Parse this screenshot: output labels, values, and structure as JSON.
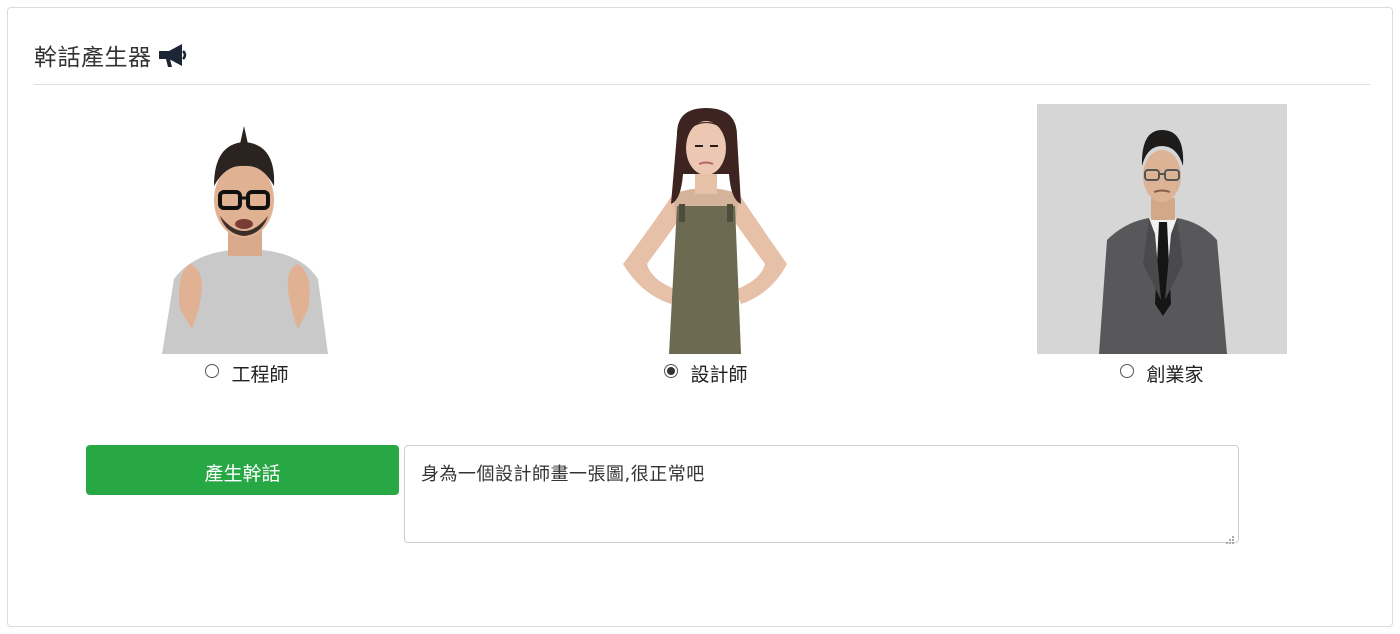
{
  "page": {
    "title": "幹話產生器",
    "title_icon": "megaphone-icon"
  },
  "roles": [
    {
      "label": "工程師",
      "checked": false,
      "image": "angry-man-grey-tshirt-photo"
    },
    {
      "label": "設計師",
      "checked": true,
      "image": "woman-in-apron-photo"
    },
    {
      "label": "創業家",
      "checked": false,
      "image": "man-in-suit-photo"
    }
  ],
  "actions": {
    "generate_label": "產生幹話"
  },
  "output": {
    "text": "身為一個設計師畫一張圖,很正常吧"
  },
  "colors": {
    "primary_button": "#28a745",
    "border": "#dcdcdc"
  }
}
